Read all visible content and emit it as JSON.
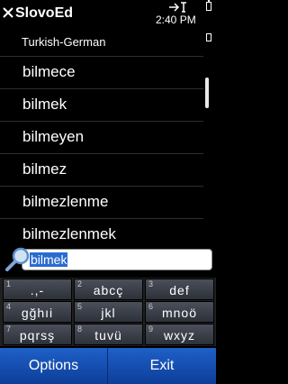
{
  "app": {
    "title": "SlovoEd",
    "clock": "2:40 PM"
  },
  "dictionary": "Turkish-German",
  "words": [
    "bilmece",
    "bilmek",
    "bilmeyen",
    "bilmez",
    "bilmezlenme",
    "bilmezlenmek"
  ],
  "search": {
    "value": "bilmek"
  },
  "keypad": [
    {
      "num": "1",
      "letters": ".,-"
    },
    {
      "num": "2",
      "letters": "abcç"
    },
    {
      "num": "3",
      "letters": "def"
    },
    {
      "num": "4",
      "letters": "gğhıi"
    },
    {
      "num": "5",
      "letters": "jkl"
    },
    {
      "num": "6",
      "letters": "mnoö"
    },
    {
      "num": "7",
      "letters": "pqrsş"
    },
    {
      "num": "8",
      "letters": "tuvü"
    },
    {
      "num": "9",
      "letters": "wxyz"
    }
  ],
  "softkeys": {
    "left": "Options",
    "right": "Exit"
  },
  "colors": {
    "selection": "#2a6bd0",
    "softkey_bar": "#1f60c8",
    "key_bg": "#3a3f48"
  }
}
